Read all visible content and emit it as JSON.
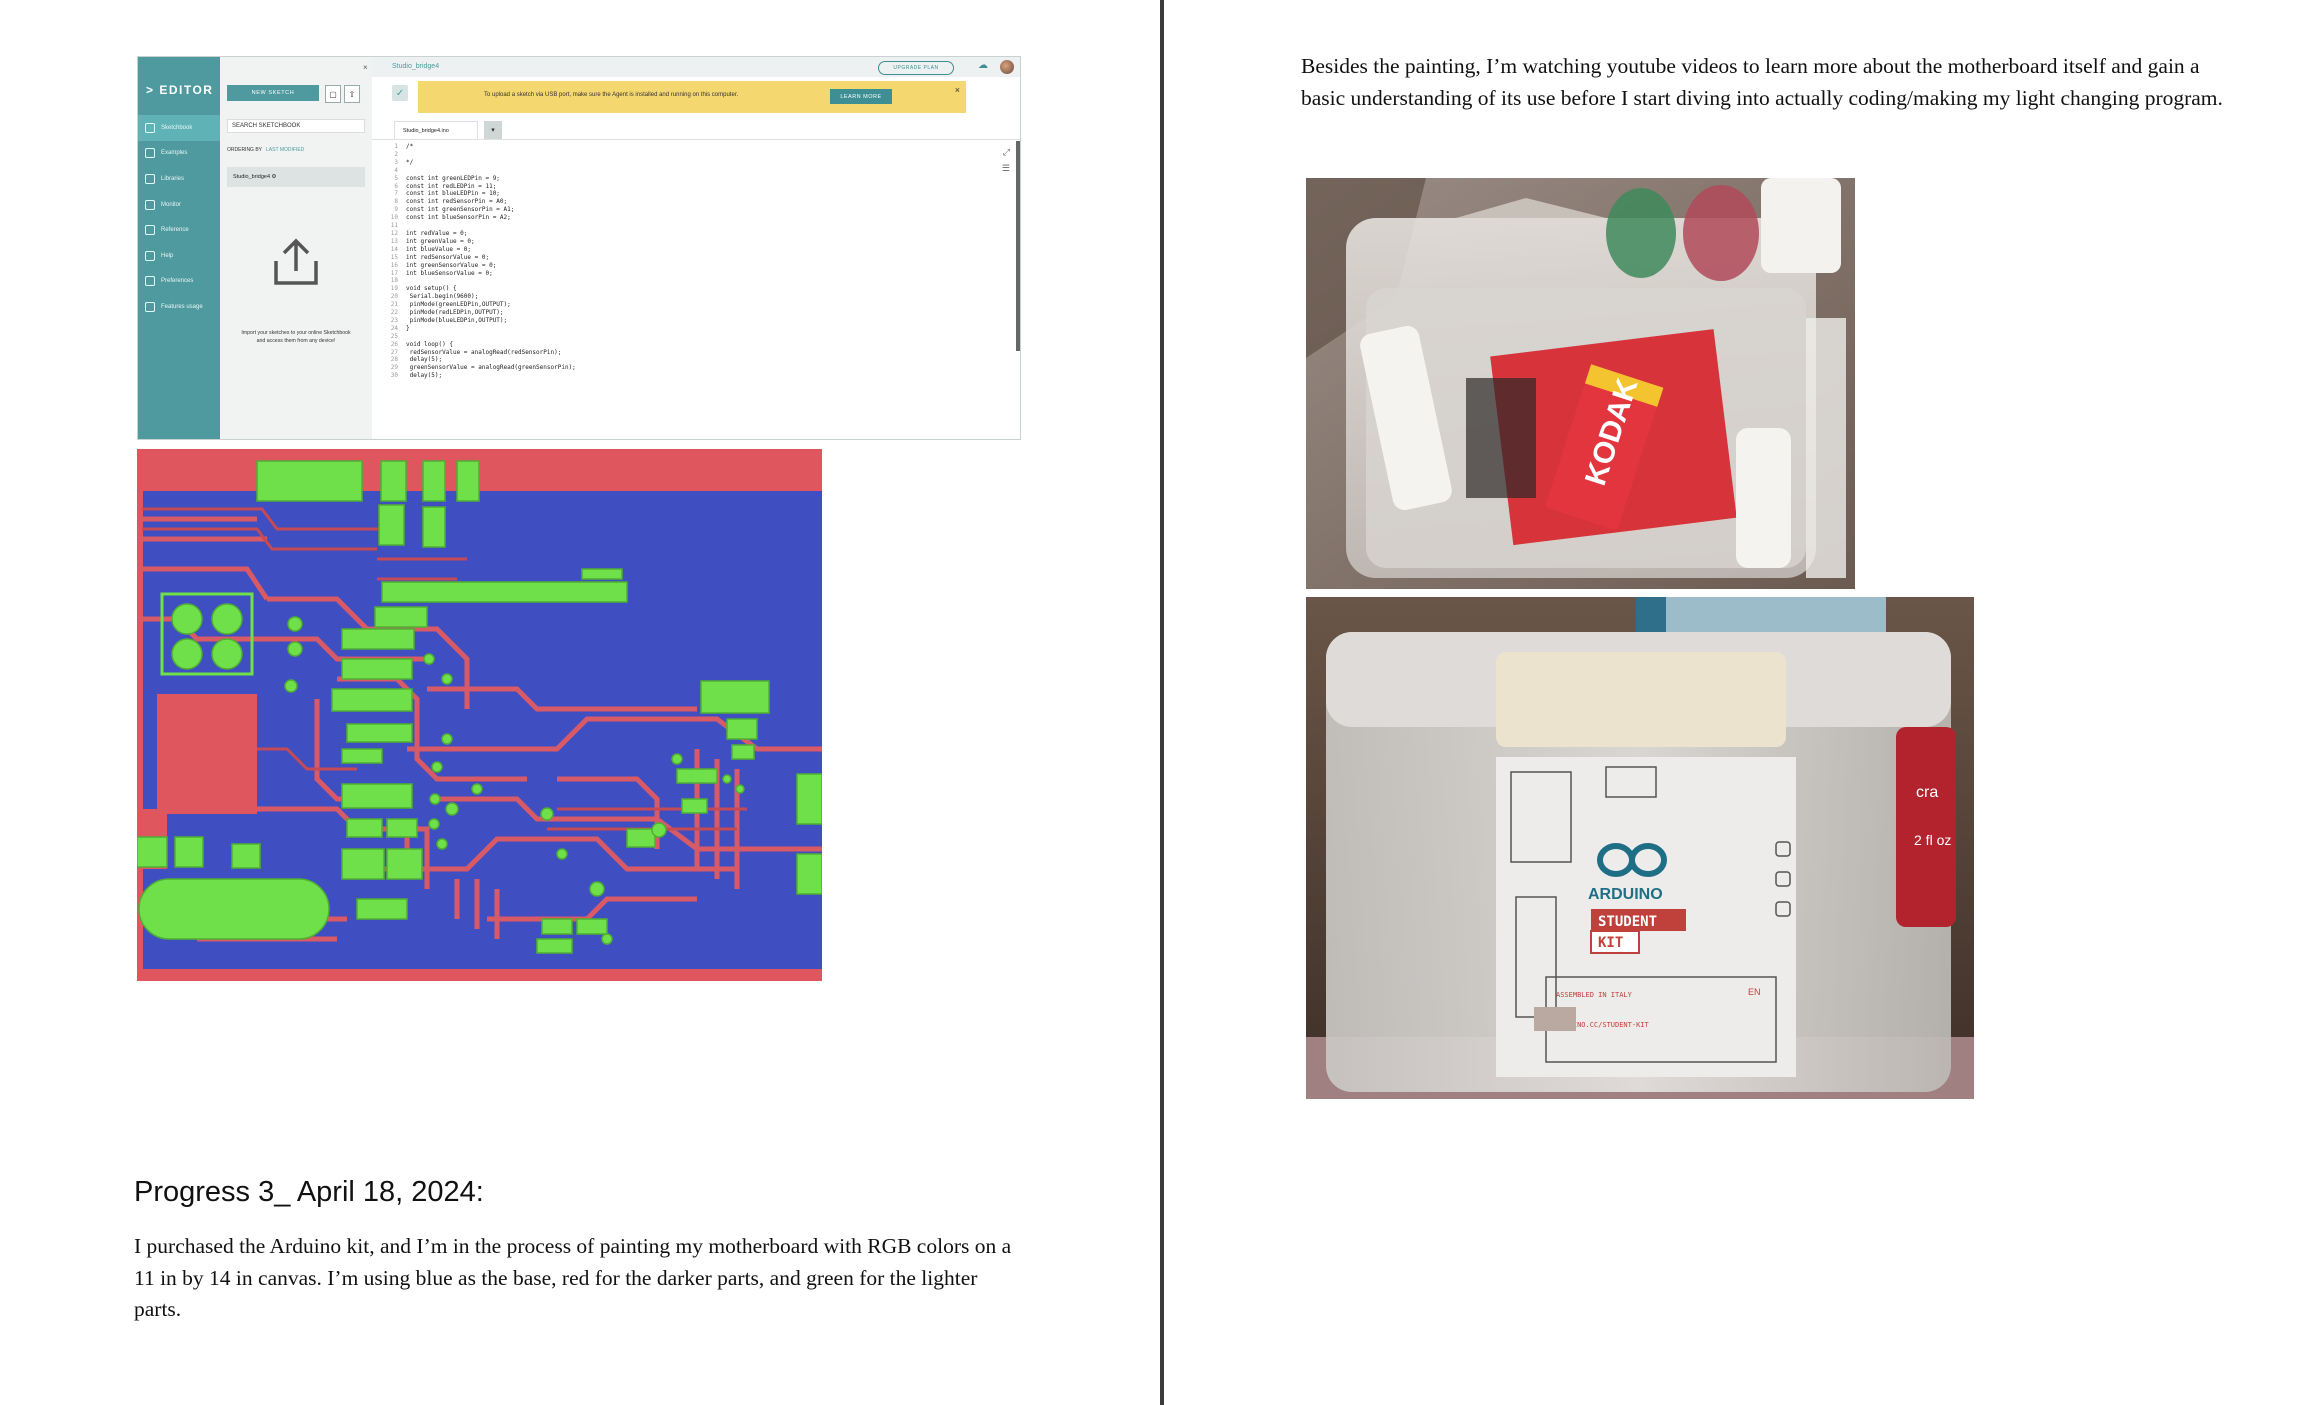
{
  "editor": {
    "logo": "EDITOR",
    "nav": [
      "Sketchbook",
      "Examples",
      "Libraries",
      "Monitor",
      "Reference",
      "Help",
      "Preferences",
      "Features usage"
    ],
    "new_sketch": "NEW SKETCH",
    "search_placeholder": "SEARCH SKETCHBOOK",
    "ordering_label": "ORDERING BY",
    "ordering_value": "LAST MODIFIED",
    "sketch_item": "Studio_bridge4",
    "import_text": "Import your sketches to your online Sketchbook and access them from any device!",
    "sketch_title": "Studio_bridge4",
    "upgrade_label": "UPGRADE PLAN",
    "banner_text": "To upload a sketch via USB port, make sure the Agent is installed and running on this computer.",
    "learn_more": "LEARN MORE",
    "file_tab": "Studio_bridge4.ino",
    "code_lines": [
      {
        "n": "1",
        "t": "/*"
      },
      {
        "n": "2",
        "t": ""
      },
      {
        "n": "3",
        "t": "*/"
      },
      {
        "n": "4",
        "t": ""
      },
      {
        "n": "5",
        "t": "const int greenLEDPin = 9;"
      },
      {
        "n": "6",
        "t": "const int redLEDPin = 11;"
      },
      {
        "n": "7",
        "t": "const int blueLEDPin = 10;"
      },
      {
        "n": "8",
        "t": "const int redSensorPin = A0;"
      },
      {
        "n": "9",
        "t": "const int greenSensorPin = A1;"
      },
      {
        "n": "10",
        "t": "const int blueSensorPin = A2;"
      },
      {
        "n": "11",
        "t": ""
      },
      {
        "n": "12",
        "t": "int redValue = 0;"
      },
      {
        "n": "13",
        "t": "int greenValue = 0;"
      },
      {
        "n": "14",
        "t": "int blueValue = 0;"
      },
      {
        "n": "15",
        "t": "int redSensorValue = 0;"
      },
      {
        "n": "16",
        "t": "int greenSensorValue = 0;"
      },
      {
        "n": "17",
        "t": "int blueSensorValue = 0;"
      },
      {
        "n": "18",
        "t": ""
      },
      {
        "n": "19",
        "t": "void setup() {"
      },
      {
        "n": "20",
        "t": "  Serial.begin(9600);"
      },
      {
        "n": "21",
        "t": "  pinMode(greenLEDPin,OUTPUT);"
      },
      {
        "n": "22",
        "t": "  pinMode(redLEDPin,OUTPUT);"
      },
      {
        "n": "23",
        "t": "  pinMode(blueLEDPin,OUTPUT);"
      },
      {
        "n": "24",
        "t": "}"
      },
      {
        "n": "25",
        "t": ""
      },
      {
        "n": "26",
        "t": "void loop() {"
      },
      {
        "n": "27",
        "t": "  redSensorValue = analogRead(redSensorPin);"
      },
      {
        "n": "28",
        "t": "  delay(5);"
      },
      {
        "n": "29",
        "t": "  greenSensorValue = analogRead(greenSensorPin);"
      },
      {
        "n": "30",
        "t": "  delay(5);"
      }
    ]
  },
  "photo_labels": {
    "battery_brand": "KODAK",
    "kit_brand": "ARDUINO",
    "kit_name_1": "STUDENT",
    "kit_name_2": "KIT",
    "kit_origin": "ASSEMBLED IN ITALY",
    "kit_url": "ARDUINO.CC/STUDENT-KIT",
    "kit_lang": "EN",
    "bottle_text": "2 fl oz",
    "bottle_brand": "cra"
  },
  "left": {
    "heading": "Progress 3_ April 18, 2024:",
    "paragraph": "I purchased the Arduino kit, and I’m in the process of painting my motherboard with RGB colors on a 11 in by 14 in canvas. I’m using blue as the base, red for the darker parts, and green for the lighter parts."
  },
  "right": {
    "paragraph": "Besides the painting, I’m watching youtube videos to learn more about the motherboard itself and gain a basic understanding of its use before I start diving into actually coding/making my light changing program."
  },
  "colors": {
    "canvas_blue": "#3f4ec0",
    "canvas_red": "#e0565e",
    "canvas_green": "#6fe04a",
    "editor_teal": "#4e9a9f",
    "banner_yellow": "#f5d76f"
  }
}
